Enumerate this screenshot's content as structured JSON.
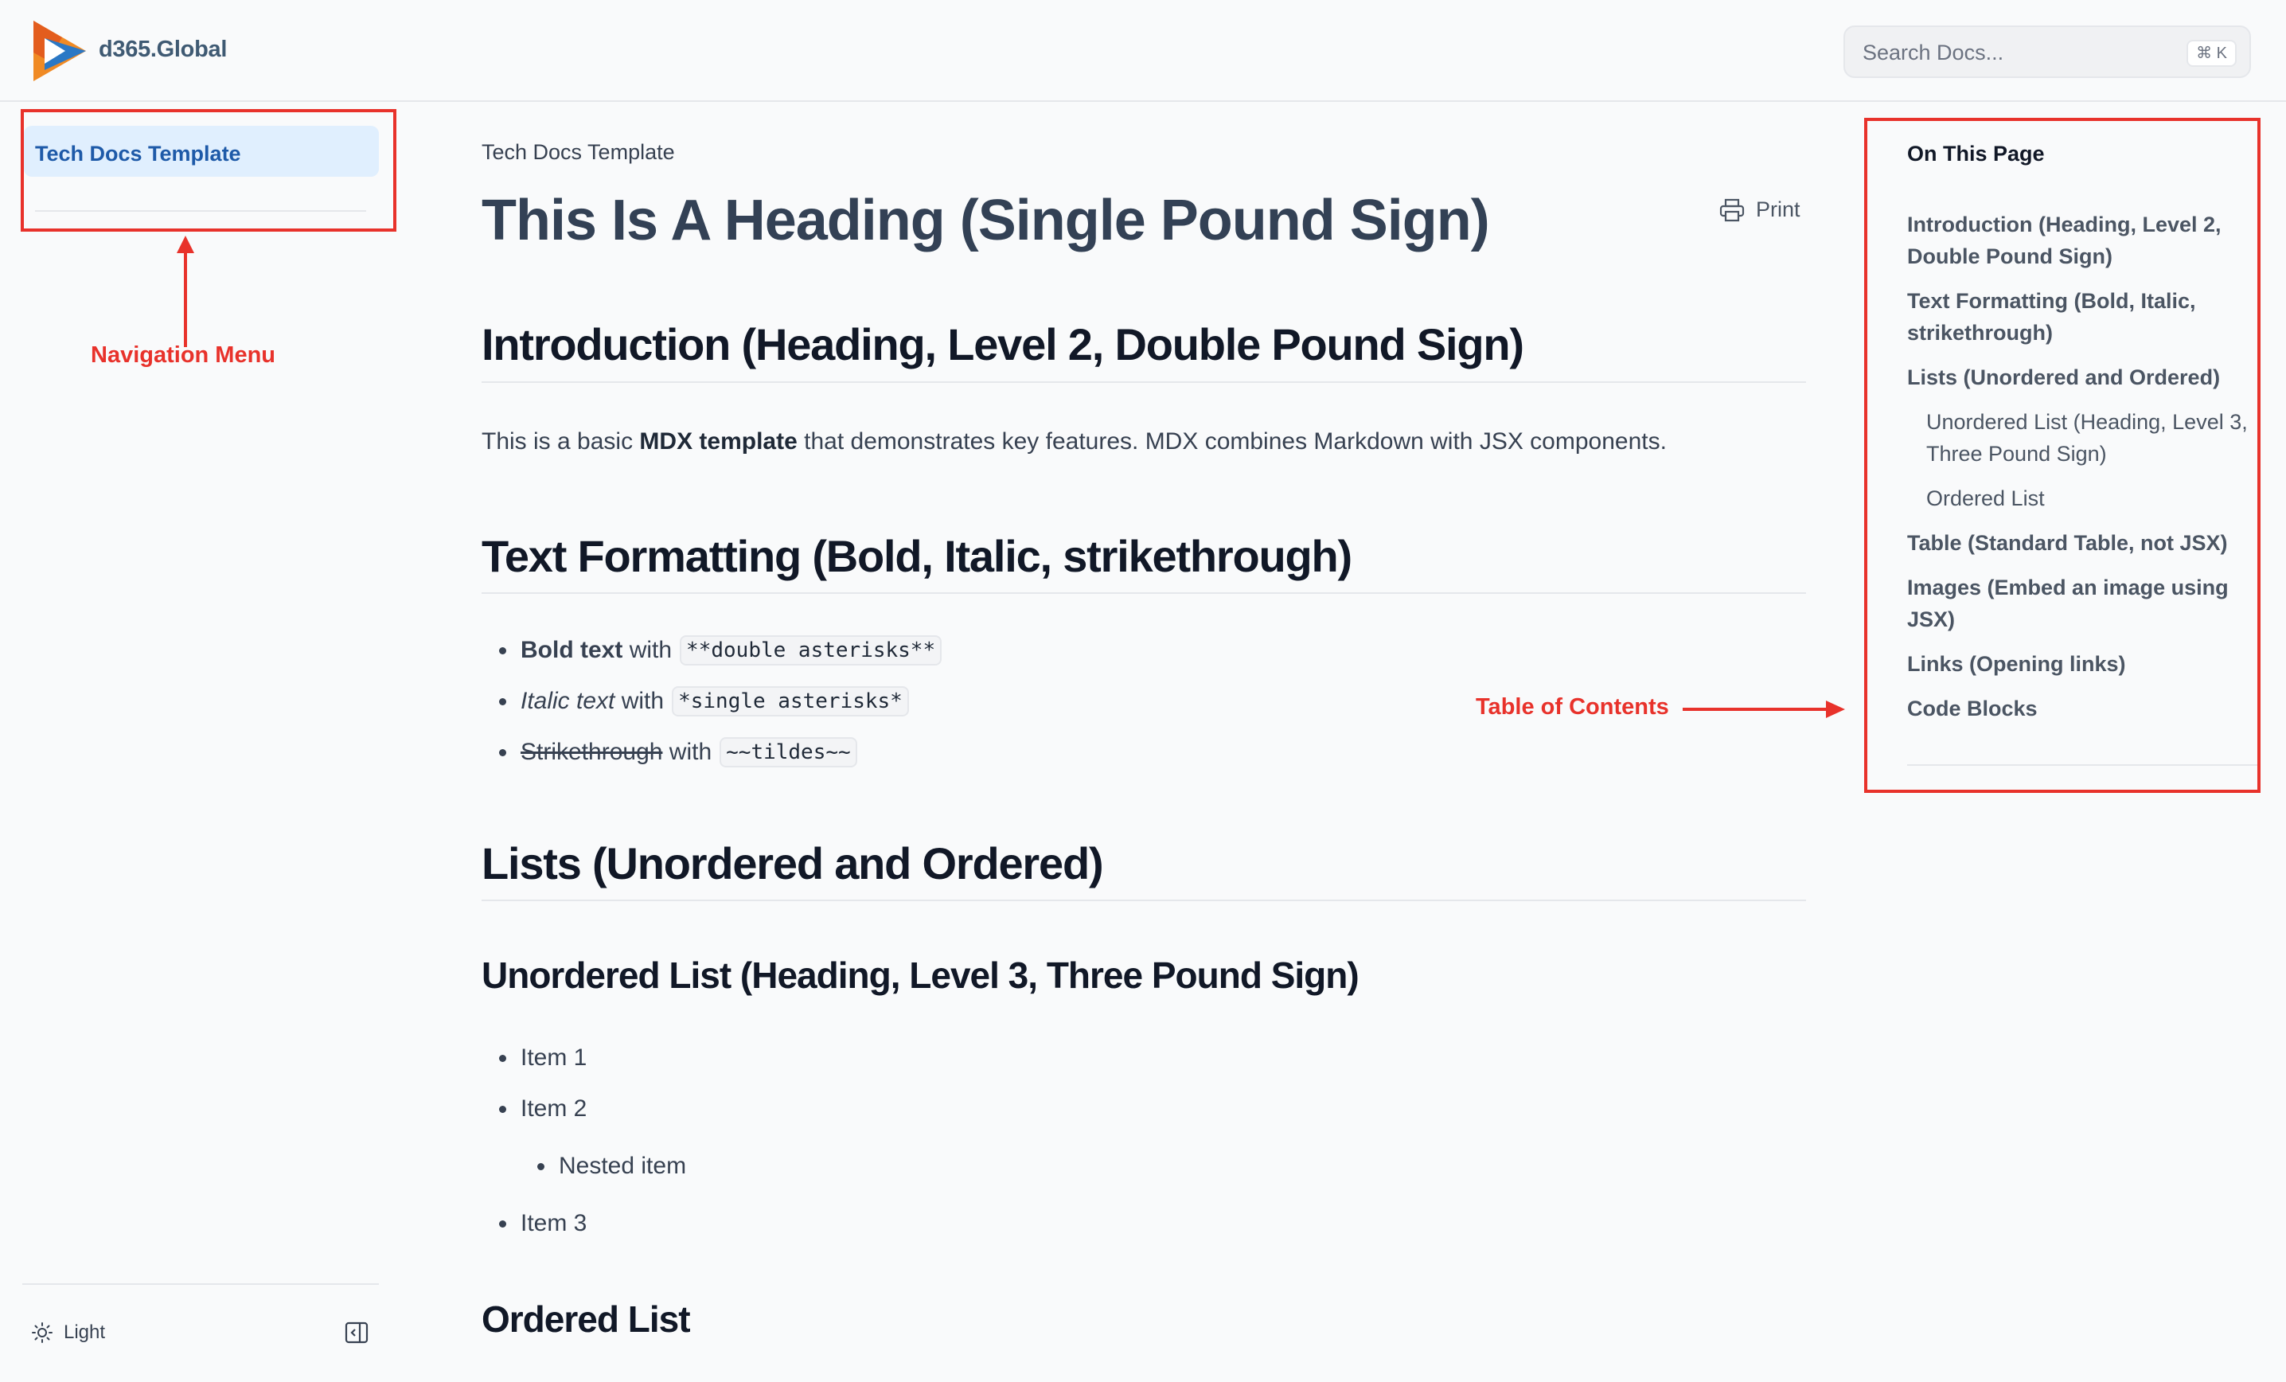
{
  "header": {
    "brand": "d365.Global",
    "search_placeholder": "Search Docs...",
    "search_shortcut": "⌘ K"
  },
  "sidebar": {
    "items": [
      {
        "label": "Tech Docs Template",
        "active": true
      }
    ],
    "theme_label": "Light"
  },
  "annotations": {
    "nav_label": "Navigation Menu",
    "toc_label": "Table of Contents",
    "color": "#e8322b"
  },
  "main": {
    "breadcrumb": "Tech Docs Template",
    "title": "This Is A Heading (Single Pound Sign)",
    "print_label": "Print",
    "intro_heading": "Introduction (Heading, Level 2, Double Pound Sign)",
    "intro_text_before": "This is a basic",
    "intro_text_bold": "MDX template",
    "intro_text_after": "that demonstrates key features. MDX combines Markdown with JSX components.",
    "formatting_heading": "Text Formatting (Bold, Italic, strikethrough)",
    "formatting_items": [
      {
        "styled": "Bold text",
        "with": "with",
        "code": "**double asterisks**"
      },
      {
        "styled": "Italic text",
        "with": "with",
        "code": "*single asterisks*"
      },
      {
        "styled": "Strikethrough",
        "with": "with",
        "code": "~~tildes~~"
      }
    ],
    "lists_heading": "Lists (Unordered and Ordered)",
    "unordered_heading": "Unordered List (Heading, Level 3, Three Pound Sign)",
    "unordered_items": [
      "Item 1",
      "Item 2",
      "Nested item",
      "Item 3"
    ],
    "ordered_heading": "Ordered List"
  },
  "toc": {
    "title": "On This Page",
    "links": [
      "Introduction (Heading, Level 2, Double Pound Sign)",
      "Text Formatting (Bold, Italic, strikethrough)",
      "Lists (Unordered and Ordered)",
      "Unordered List (Heading, Level 3, Three Pound Sign)",
      "Ordered List",
      "Table (Standard Table, not JSX)",
      "Images (Embed an image using JSX)",
      "Links (Opening links)",
      "Code Blocks"
    ]
  }
}
